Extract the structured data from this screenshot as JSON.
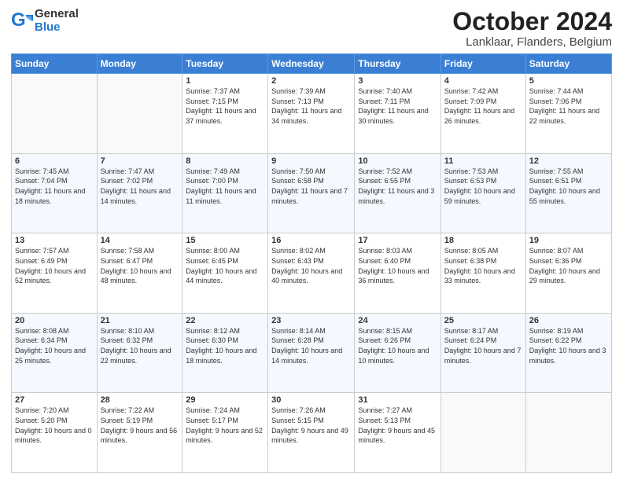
{
  "logo": {
    "general": "General",
    "blue": "Blue"
  },
  "title": "October 2024",
  "subtitle": "Lanklaar, Flanders, Belgium",
  "days_of_week": [
    "Sunday",
    "Monday",
    "Tuesday",
    "Wednesday",
    "Thursday",
    "Friday",
    "Saturday"
  ],
  "weeks": [
    [
      {
        "day": "",
        "info": ""
      },
      {
        "day": "",
        "info": ""
      },
      {
        "day": "1",
        "info": "Sunrise: 7:37 AM\nSunset: 7:15 PM\nDaylight: 11 hours and 37 minutes."
      },
      {
        "day": "2",
        "info": "Sunrise: 7:39 AM\nSunset: 7:13 PM\nDaylight: 11 hours and 34 minutes."
      },
      {
        "day": "3",
        "info": "Sunrise: 7:40 AM\nSunset: 7:11 PM\nDaylight: 11 hours and 30 minutes."
      },
      {
        "day": "4",
        "info": "Sunrise: 7:42 AM\nSunset: 7:09 PM\nDaylight: 11 hours and 26 minutes."
      },
      {
        "day": "5",
        "info": "Sunrise: 7:44 AM\nSunset: 7:06 PM\nDaylight: 11 hours and 22 minutes."
      }
    ],
    [
      {
        "day": "6",
        "info": "Sunrise: 7:45 AM\nSunset: 7:04 PM\nDaylight: 11 hours and 18 minutes."
      },
      {
        "day": "7",
        "info": "Sunrise: 7:47 AM\nSunset: 7:02 PM\nDaylight: 11 hours and 14 minutes."
      },
      {
        "day": "8",
        "info": "Sunrise: 7:49 AM\nSunset: 7:00 PM\nDaylight: 11 hours and 11 minutes."
      },
      {
        "day": "9",
        "info": "Sunrise: 7:50 AM\nSunset: 6:58 PM\nDaylight: 11 hours and 7 minutes."
      },
      {
        "day": "10",
        "info": "Sunrise: 7:52 AM\nSunset: 6:55 PM\nDaylight: 11 hours and 3 minutes."
      },
      {
        "day": "11",
        "info": "Sunrise: 7:53 AM\nSunset: 6:53 PM\nDaylight: 10 hours and 59 minutes."
      },
      {
        "day": "12",
        "info": "Sunrise: 7:55 AM\nSunset: 6:51 PM\nDaylight: 10 hours and 55 minutes."
      }
    ],
    [
      {
        "day": "13",
        "info": "Sunrise: 7:57 AM\nSunset: 6:49 PM\nDaylight: 10 hours and 52 minutes."
      },
      {
        "day": "14",
        "info": "Sunrise: 7:58 AM\nSunset: 6:47 PM\nDaylight: 10 hours and 48 minutes."
      },
      {
        "day": "15",
        "info": "Sunrise: 8:00 AM\nSunset: 6:45 PM\nDaylight: 10 hours and 44 minutes."
      },
      {
        "day": "16",
        "info": "Sunrise: 8:02 AM\nSunset: 6:43 PM\nDaylight: 10 hours and 40 minutes."
      },
      {
        "day": "17",
        "info": "Sunrise: 8:03 AM\nSunset: 6:40 PM\nDaylight: 10 hours and 36 minutes."
      },
      {
        "day": "18",
        "info": "Sunrise: 8:05 AM\nSunset: 6:38 PM\nDaylight: 10 hours and 33 minutes."
      },
      {
        "day": "19",
        "info": "Sunrise: 8:07 AM\nSunset: 6:36 PM\nDaylight: 10 hours and 29 minutes."
      }
    ],
    [
      {
        "day": "20",
        "info": "Sunrise: 8:08 AM\nSunset: 6:34 PM\nDaylight: 10 hours and 25 minutes."
      },
      {
        "day": "21",
        "info": "Sunrise: 8:10 AM\nSunset: 6:32 PM\nDaylight: 10 hours and 22 minutes."
      },
      {
        "day": "22",
        "info": "Sunrise: 8:12 AM\nSunset: 6:30 PM\nDaylight: 10 hours and 18 minutes."
      },
      {
        "day": "23",
        "info": "Sunrise: 8:14 AM\nSunset: 6:28 PM\nDaylight: 10 hours and 14 minutes."
      },
      {
        "day": "24",
        "info": "Sunrise: 8:15 AM\nSunset: 6:26 PM\nDaylight: 10 hours and 10 minutes."
      },
      {
        "day": "25",
        "info": "Sunrise: 8:17 AM\nSunset: 6:24 PM\nDaylight: 10 hours and 7 minutes."
      },
      {
        "day": "26",
        "info": "Sunrise: 8:19 AM\nSunset: 6:22 PM\nDaylight: 10 hours and 3 minutes."
      }
    ],
    [
      {
        "day": "27",
        "info": "Sunrise: 7:20 AM\nSunset: 5:20 PM\nDaylight: 10 hours and 0 minutes."
      },
      {
        "day": "28",
        "info": "Sunrise: 7:22 AM\nSunset: 5:19 PM\nDaylight: 9 hours and 56 minutes."
      },
      {
        "day": "29",
        "info": "Sunrise: 7:24 AM\nSunset: 5:17 PM\nDaylight: 9 hours and 52 minutes."
      },
      {
        "day": "30",
        "info": "Sunrise: 7:26 AM\nSunset: 5:15 PM\nDaylight: 9 hours and 49 minutes."
      },
      {
        "day": "31",
        "info": "Sunrise: 7:27 AM\nSunset: 5:13 PM\nDaylight: 9 hours and 45 minutes."
      },
      {
        "day": "",
        "info": ""
      },
      {
        "day": "",
        "info": ""
      }
    ]
  ]
}
